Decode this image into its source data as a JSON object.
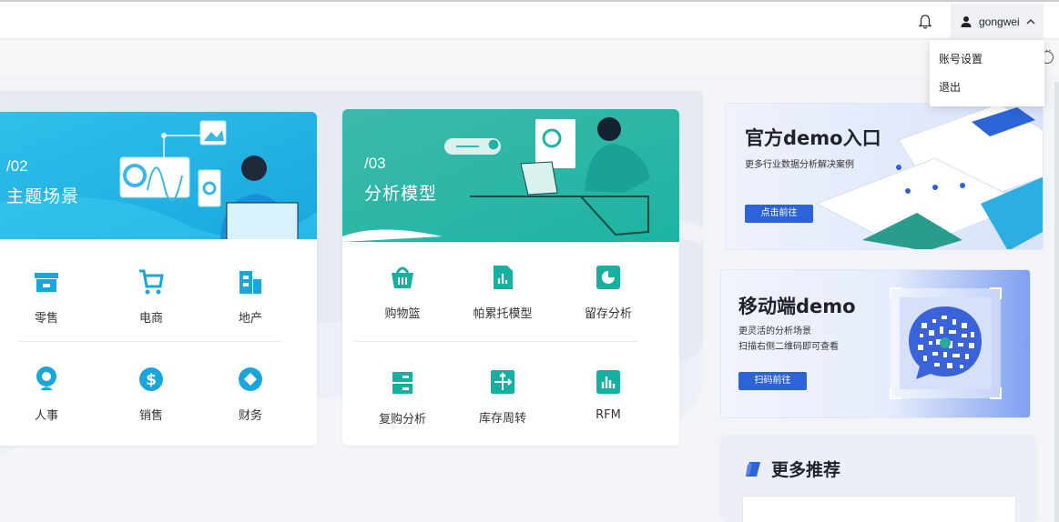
{
  "header": {
    "username": "gongwei",
    "user_menu": [
      {
        "label": "账号设置"
      },
      {
        "label": "退出"
      }
    ]
  },
  "scenario_card": {
    "tag": "/02",
    "title": "主题场景",
    "items": [
      {
        "label": "零售",
        "icon": "store-icon"
      },
      {
        "label": "电商",
        "icon": "cart-icon"
      },
      {
        "label": "地产",
        "icon": "building-icon"
      },
      {
        "label": "人事",
        "icon": "person-icon"
      },
      {
        "label": "销售",
        "icon": "dollar-icon"
      },
      {
        "label": "财务",
        "icon": "diamond-icon"
      }
    ],
    "accent": "#2ebde3"
  },
  "model_card": {
    "tag": "/03",
    "title": "分析模型",
    "items": [
      {
        "label": "购物篮",
        "icon": "basket-icon"
      },
      {
        "label": "帕累托模型",
        "icon": "bar-chart-icon"
      },
      {
        "label": "留存分析",
        "icon": "pie-chart-icon"
      },
      {
        "label": "复购分析",
        "icon": "stack-icon"
      },
      {
        "label": "库存周转",
        "icon": "axis-icon"
      },
      {
        "label": "RFM",
        "icon": "column-chart-icon"
      }
    ],
    "accent": "#1eb3a2"
  },
  "official_demo": {
    "title": "官方demo入口",
    "subtitle": "更多行业数据分析解决案例",
    "button": "点击前往"
  },
  "mobile_demo": {
    "title": "移动端demo",
    "line1": "更灵活的分析场景",
    "line2": "扫描右侧二维码即可查看",
    "button": "扫码前往"
  },
  "recommend": {
    "title": "更多推荐"
  },
  "colors": {
    "primary_button": "#2c63d6",
    "teal": "#17b0a0",
    "blue": "#1f9fdc"
  }
}
